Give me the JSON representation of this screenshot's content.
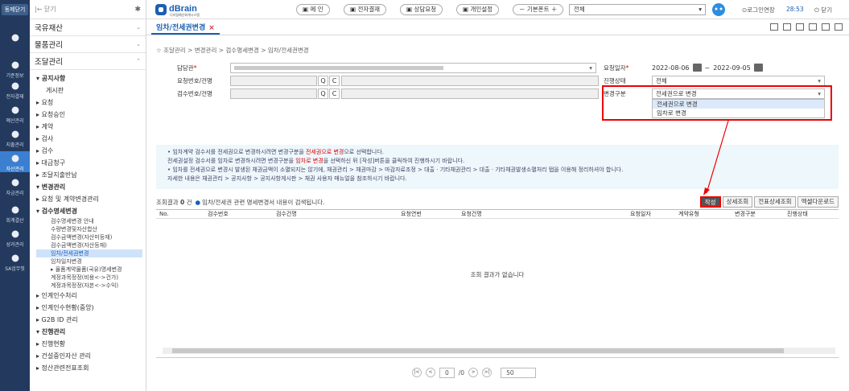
{
  "rail": {
    "close_label": "동제닫기",
    "items": [
      {
        "label": "",
        "icon": "search-icon"
      },
      {
        "label": "기준정보",
        "icon": "home-icon"
      },
      {
        "label": "전자결재",
        "icon": "send-icon"
      },
      {
        "label": "예산관리",
        "icon": "coins-icon"
      },
      {
        "label": "지출관리",
        "icon": "pay-icon"
      },
      {
        "label": "자산관리",
        "icon": "building-icon"
      },
      {
        "label": "자금관리",
        "icon": "fund-icon"
      },
      {
        "label": "회계결산",
        "icon": "ledger-icon"
      },
      {
        "label": "성과관리",
        "icon": "chart-icon"
      },
      {
        "label": "SA업무첫",
        "icon": "folder-icon"
      }
    ]
  },
  "menu": {
    "top_label": "|← 닫기",
    "pin": "✱",
    "categories": [
      {
        "label": "국유재산",
        "chev": "⌄"
      },
      {
        "label": "물품관리",
        "chev": "⌄"
      },
      {
        "label": "조달관리",
        "chev": "⌃"
      }
    ],
    "items": [
      {
        "label": "▾ 공지사항",
        "cls": "bold"
      },
      {
        "label": "게시판",
        "cls": "sub"
      },
      {
        "label": "▸ 요청",
        "cls": ""
      },
      {
        "label": "▸ 요청승인",
        "cls": ""
      },
      {
        "label": "▸ 계약",
        "cls": ""
      },
      {
        "label": "▸ 검사",
        "cls": ""
      },
      {
        "label": "▸ 검수",
        "cls": ""
      },
      {
        "label": "▸ 대금청구",
        "cls": ""
      },
      {
        "label": "▸ 조달지출반납",
        "cls": ""
      },
      {
        "label": "▾ 변경관리",
        "cls": "bold"
      },
      {
        "label": "▸ 요청 및 계약변경관리",
        "cls": ""
      },
      {
        "label": "▾ 검수명세변경",
        "cls": "bold"
      },
      {
        "label": "검수명세변경 안내",
        "cls": "sub2"
      },
      {
        "label": "수량변경및자산합산",
        "cls": "sub2"
      },
      {
        "label": "검수금액변경(자산미등재)",
        "cls": "sub2"
      },
      {
        "label": "검수금액변경(자산등재)",
        "cls": "sub2"
      },
      {
        "label": "임차/전세권변경",
        "cls": "sub2 sel"
      },
      {
        "label": "임차일자변경",
        "cls": "sub2"
      },
      {
        "label": "▸ 물품계약물품(국유)명세변경",
        "cls": "sub2"
      },
      {
        "label": "계정과목정정(비용<->건가)",
        "cls": "sub2"
      },
      {
        "label": "계정과목정정(자본<->수익)",
        "cls": "sub2"
      },
      {
        "label": "▸ 인계인수처리",
        "cls": ""
      },
      {
        "label": "▸ 인계인수현황(중앙)",
        "cls": ""
      },
      {
        "label": "▸ G2B ID 관리",
        "cls": ""
      },
      {
        "label": "▾ 진행관리",
        "cls": "bold"
      },
      {
        "label": "▸ 진행현황",
        "cls": ""
      },
      {
        "label": "▸ 건설중인자산 관리",
        "cls": ""
      },
      {
        "label": "▸ 정산관련전표조회",
        "cls": ""
      }
    ]
  },
  "header": {
    "logo_text": "dBrain",
    "logo_sub": "디지털예산회계시스템",
    "buttons": [
      "메 인",
      "전자결재",
      "상담요청",
      "개인설정"
    ],
    "font_ctrl": "－  기본폰트  ＋",
    "scope": "전체",
    "login_ext": "⊙로그인연장",
    "timer": "28:53",
    "logout": "⏻ 닫기"
  },
  "tab": {
    "label": "임차/전세권변경",
    "close": "×"
  },
  "breadcrumb": "☆ 조달관리 > 변경관리 > 검수명세변경 > 임차/전세권변경",
  "form": {
    "manager_label": "담당관",
    "req_no_label": "요청번호/건명",
    "insp_no_label": "검수번호/건명",
    "req_date_label": "요청일자",
    "date_from": "2022-08-06",
    "date_sep": "~",
    "date_to": "2022-09-05",
    "status_label": "진행상태",
    "status_value": "전체",
    "change_type_label": "변경구분",
    "change_type_value": "전세권으로 변경",
    "change_type_options": [
      "전세권으로 변경",
      "임차로 변경"
    ]
  },
  "info_lines": [
    [
      "• 임차계약 검수서를 전세권으로 변경하시려면 변경구분을 ",
      "전세권으로 변경",
      "으로 선택합니다."
    ],
    [
      "  전세권설정 검수서를 임차로 변경하시려면 변경구분을 ",
      "임차로 변경",
      "을 선택하신 뒤 [작성]버튼을 클릭하여 진행하시기 바랍니다."
    ],
    [
      "• 임차를 전세권으로 변경시 발생된 채권금액이 소멸되지는 않기에, 채권관리 > 채권마감 > 마감자료조정 > 대출 · 기타채권관리 > 대출 · 기타채권발생소멸처리 탭을 이용해 정리하셔야 합니다.",
      "",
      ""
    ],
    [
      "  자세한 내용은 채권관리 > 공지사항 > 공지사항게시판 > 채권 사용자 매뉴얼을 참조하시기 바랍니다.",
      "",
      ""
    ]
  ],
  "result": {
    "prefix": "조회결과",
    "count": "0",
    "suffix": "건",
    "note": "임차/전세권 관련 명세변경서 내용이 검색됩니다.",
    "buttons": [
      "작성",
      "상세조회",
      "전표상세조회",
      "엑셀다운로드"
    ]
  },
  "grid": {
    "columns": [
      "No.",
      "검수번호",
      "검수건명",
      "요청연번",
      "요청건명",
      "요청일자",
      "계약유형",
      "변경구분",
      "진행상태"
    ],
    "empty_text": "조회 결과가 없습니다"
  },
  "pager": {
    "page": "0",
    "of": "/0",
    "size": "50"
  }
}
